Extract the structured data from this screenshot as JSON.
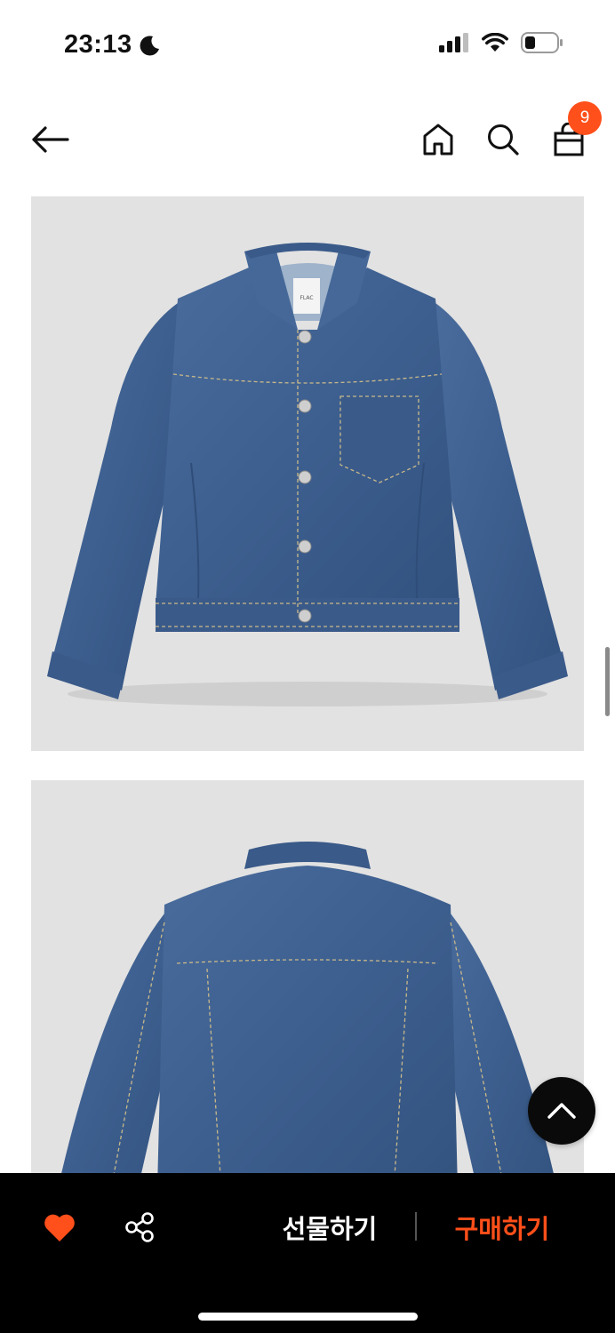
{
  "status_bar": {
    "time": "23:13",
    "icons": [
      "moon-icon",
      "cellular-signal-icon",
      "wifi-icon",
      "battery-icon"
    ]
  },
  "header": {
    "icons": [
      "back-arrow-icon",
      "home-icon",
      "search-icon",
      "shopping-bag-icon"
    ],
    "cart_count": "9"
  },
  "gallery": {
    "images": [
      "denim-jacket-front",
      "denim-jacket-back"
    ],
    "collar_label_text": "FLAC"
  },
  "bottom_bar": {
    "gift_label": "선물하기",
    "buy_label": "구매하기",
    "icons": [
      "heart-icon",
      "share-icon"
    ]
  },
  "colors": {
    "accent": "#ff4f1a",
    "bar_background": "#000000",
    "image_background": "#e2e2e2",
    "denim": "#3d5f8f"
  }
}
